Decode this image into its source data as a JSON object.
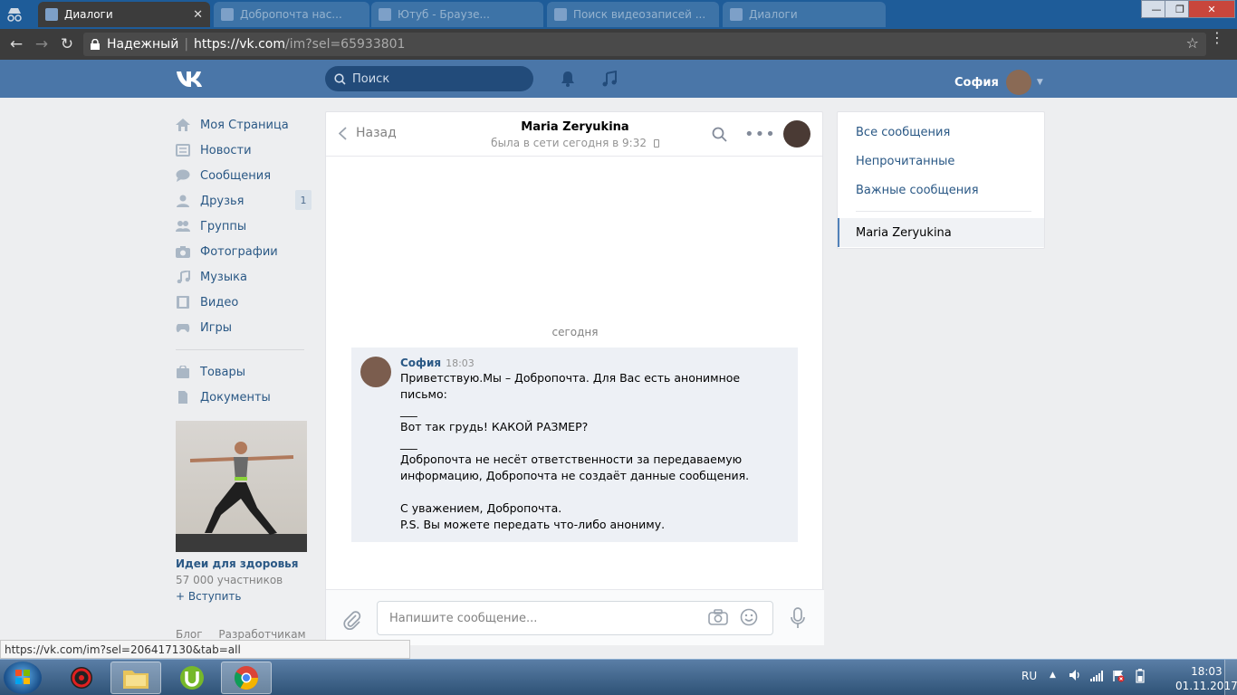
{
  "browser": {
    "tabs": [
      {
        "label": "Диалоги",
        "active": true
      },
      {
        "label": "Добропочта нас...",
        "active": false
      },
      {
        "label": "Ютуб - Браузе...",
        "active": false
      },
      {
        "label": "Поиск видеозаписей ...",
        "active": false
      },
      {
        "label": "Диалоги",
        "active": false
      }
    ],
    "secure_label": "Надежный",
    "url_host": "https://vk.com",
    "url_path": "/im?sel=65933801",
    "status_url": "https://vk.com/im?sel=206417130&tab=all"
  },
  "vk_header": {
    "logo": "VK",
    "search_placeholder": "Поиск",
    "user_name": "София"
  },
  "sidebar": {
    "items": [
      {
        "label": "Моя Страница",
        "icon": "home-icon"
      },
      {
        "label": "Новости",
        "icon": "news-icon"
      },
      {
        "label": "Сообщения",
        "icon": "messages-icon"
      },
      {
        "label": "Друзья",
        "icon": "friends-icon",
        "badge": "1"
      },
      {
        "label": "Группы",
        "icon": "groups-icon"
      },
      {
        "label": "Фотографии",
        "icon": "photo-icon"
      },
      {
        "label": "Музыка",
        "icon": "music-icon"
      },
      {
        "label": "Видео",
        "icon": "video-icon"
      },
      {
        "label": "Игры",
        "icon": "games-icon"
      }
    ],
    "items2": [
      {
        "label": "Товары",
        "icon": "goods-icon"
      },
      {
        "label": "Документы",
        "icon": "documents-icon"
      }
    ],
    "ad": {
      "title": "Идеи для здоровья",
      "members": "57 000 участников",
      "join": "+ Вступить"
    },
    "footer": {
      "blog": "Блог",
      "dev": "Разработчикам"
    }
  },
  "chat": {
    "back": "Назад",
    "peer_name": "Maria Zeryukina",
    "peer_status": "была в сети сегодня в 9:32",
    "day_label": "сегодня",
    "message": {
      "author": "София",
      "time": "18:03",
      "lines": [
        "Приветствую.Мы – Добропочта. Для Вас есть анонимное",
        "письмо:",
        "___",
        "Вот так грудь! КАКОЙ РАЗМЕР?",
        "___",
        "Добропочта не несёт ответственности за передаваемую",
        "информацию, Добропочта не создаёт данные сообщения.",
        "",
        "С уважением, Добропочта.",
        "P.S. Вы можете передать что-либо анониму."
      ]
    },
    "composer_placeholder": "Напишите сообщение..."
  },
  "right_panel": {
    "filters": [
      "Все сообщения",
      "Непрочитанные",
      "Важные сообщения"
    ],
    "active_dialog": "Maria Zeryukina"
  },
  "taskbar": {
    "lang": "RU",
    "time": "18:03",
    "date": "01.11.2017"
  }
}
